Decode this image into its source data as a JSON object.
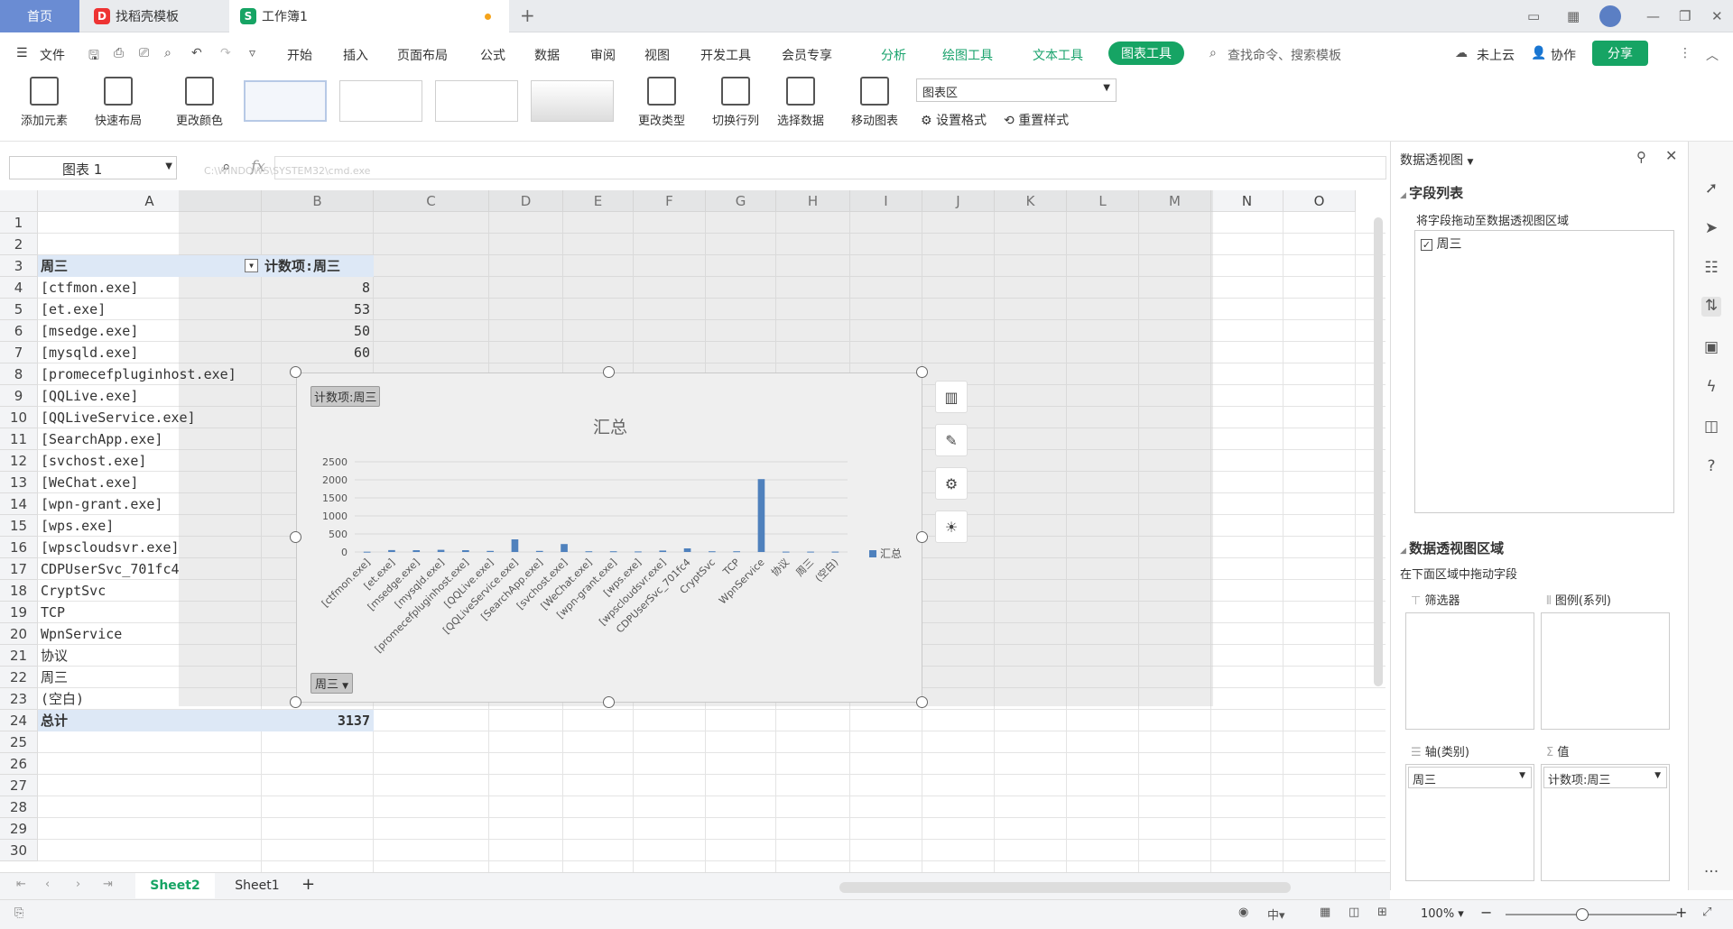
{
  "tabs": {
    "home": "首页",
    "template": "找稻壳模板",
    "workbook": "工作簿1",
    "new_tab": "+"
  },
  "menu": {
    "file": "文件",
    "items": [
      "开始",
      "插入",
      "页面布局",
      "公式",
      "数据",
      "审阅",
      "视图",
      "开发工具",
      "会员专享"
    ],
    "green_items": [
      "分析",
      "绘图工具",
      "文本工具"
    ],
    "active": "图表工具",
    "search": "查找命令、搜索模板",
    "cloud": "未上云",
    "collab": "协作",
    "share": "分享"
  },
  "ribbon": {
    "add_element": "添加元素",
    "quick_layout": "快速布局",
    "change_color": "更改颜色",
    "change_type": "更改类型",
    "switch_rowcol": "切换行列",
    "select_data": "选择数据",
    "move_chart": "移动图表",
    "chart_area": "图表区",
    "set_format": "设置格式",
    "reset_style": "重置样式"
  },
  "formula_bar": {
    "name_box": "图表 1",
    "fx": "fx",
    "bg_window_title": "C:\\WINDOWS\\SYSTEM32\\cmd.exe"
  },
  "columns": [
    "A",
    "B",
    "C",
    "D",
    "E",
    "F",
    "G",
    "H",
    "I",
    "J",
    "K",
    "L",
    "M",
    "N",
    "O"
  ],
  "rows": [
    "1",
    "2",
    "3",
    "4",
    "5",
    "6",
    "7",
    "8",
    "9",
    "10",
    "11",
    "12",
    "13",
    "14",
    "15",
    "16",
    "17",
    "18",
    "19",
    "20",
    "21",
    "22",
    "23",
    "24",
    "25",
    "26",
    "27",
    "28",
    "29",
    "30"
  ],
  "pivot": {
    "header_a": "周三",
    "header_b": "计数项:周三",
    "rows": [
      {
        "label": "[ctfmon.exe]",
        "value": "8"
      },
      {
        "label": "[et.exe]",
        "value": "53"
      },
      {
        "label": "[msedge.exe]",
        "value": "50"
      },
      {
        "label": "[mysqld.exe]",
        "value": "60"
      },
      {
        "label": "[promecefpluginhost.exe]",
        "value": ""
      },
      {
        "label": "[QQLive.exe]",
        "value": ""
      },
      {
        "label": "[QQLiveService.exe]",
        "value": ""
      },
      {
        "label": "[SearchApp.exe]",
        "value": ""
      },
      {
        "label": "[svchost.exe]",
        "value": ""
      },
      {
        "label": "[WeChat.exe]",
        "value": ""
      },
      {
        "label": "[wpn-grant.exe]",
        "value": ""
      },
      {
        "label": "[wps.exe]",
        "value": ""
      },
      {
        "label": "[wpscloudsvr.exe]",
        "value": ""
      },
      {
        "label": "CDPUserSvc_701fc4",
        "value": ""
      },
      {
        "label": "CryptSvc",
        "value": ""
      },
      {
        "label": "TCP",
        "value": ""
      },
      {
        "label": "WpnService",
        "value": ""
      },
      {
        "label": "协议",
        "value": ""
      },
      {
        "label": "周三",
        "value": ""
      },
      {
        "label": "(空白)",
        "value": ""
      }
    ],
    "total_label": "总计",
    "total_value": "3137"
  },
  "chart": {
    "field_button": "计数项:周三",
    "axis_button": "周三",
    "tool_icons": [
      "chart-elements-icon",
      "chart-style-icon",
      "chart-settings-icon",
      "chart-tip-icon"
    ]
  },
  "chart_data": {
    "type": "bar",
    "title": "汇总",
    "categories": [
      "[ctfmon.exe]",
      "[et.exe]",
      "[msedge.exe]",
      "[mysqld.exe]",
      "[promecefpluginhost.exe]",
      "[QQLive.exe]",
      "[QQLiveService.exe]",
      "[SearchApp.exe]",
      "[svchost.exe]",
      "[WeChat.exe]",
      "[wpn-grant.exe]",
      "[wps.exe]",
      "[wpscloudsvr.exe]",
      "CDPUserSvc_701fc4",
      "CryptSvc",
      "TCP",
      "WpnService",
      "协议",
      "周三",
      "(空白)"
    ],
    "series": [
      {
        "name": "汇总",
        "values": [
          8,
          53,
          50,
          60,
          50,
          30,
          350,
          30,
          220,
          20,
          20,
          15,
          40,
          100,
          20,
          20,
          2020,
          10,
          10,
          10
        ]
      }
    ],
    "ylim": [
      0,
      2500
    ],
    "yticks": [
      "0",
      "500",
      "1000",
      "1500",
      "2000",
      "2500"
    ],
    "legend": "right",
    "color": "#4f81bd"
  },
  "panel": {
    "title": "数据透视图",
    "field_list": "字段列表",
    "drag_hint": "将字段拖动至数据透视图区域",
    "field": "周三",
    "area_title": "数据透视图区域",
    "area_hint": "在下面区域中拖动字段",
    "filter": "筛选器",
    "legend": "图例(系列)",
    "axis": "轴(类别)",
    "values": "值",
    "axis_value": "周三",
    "values_value": "计数项:周三"
  },
  "sheets": {
    "active": "Sheet2",
    "other": "Sheet1",
    "add": "+"
  },
  "status": {
    "zoom": "100%"
  }
}
